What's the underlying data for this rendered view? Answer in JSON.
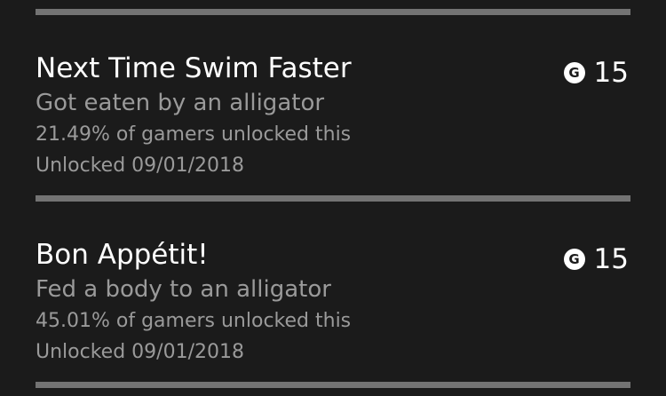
{
  "achievements": [
    {
      "title": "Next Time Swim Faster",
      "description": "Got eaten by an alligator",
      "rarity": "21.49% of gamers unlocked this",
      "unlocked": "Unlocked 09/01/2018",
      "gamerscore_icon": "G",
      "gamerscore": "15"
    },
    {
      "title": "Bon Appétit!",
      "description": "Fed a body to an alligator",
      "rarity": "45.01% of gamers unlocked this",
      "unlocked": "Unlocked 09/01/2018",
      "gamerscore_icon": "G",
      "gamerscore": "15"
    }
  ],
  "colors": {
    "background": "#1b1b1b",
    "title": "#ffffff",
    "secondary_text": "#9a9a9a",
    "progress_bar": "#737373"
  },
  "progress": {
    "top_bar_fraction": 1.0,
    "middle_bar_fraction": 1.0,
    "bottom_bar_fraction": 1.0
  }
}
